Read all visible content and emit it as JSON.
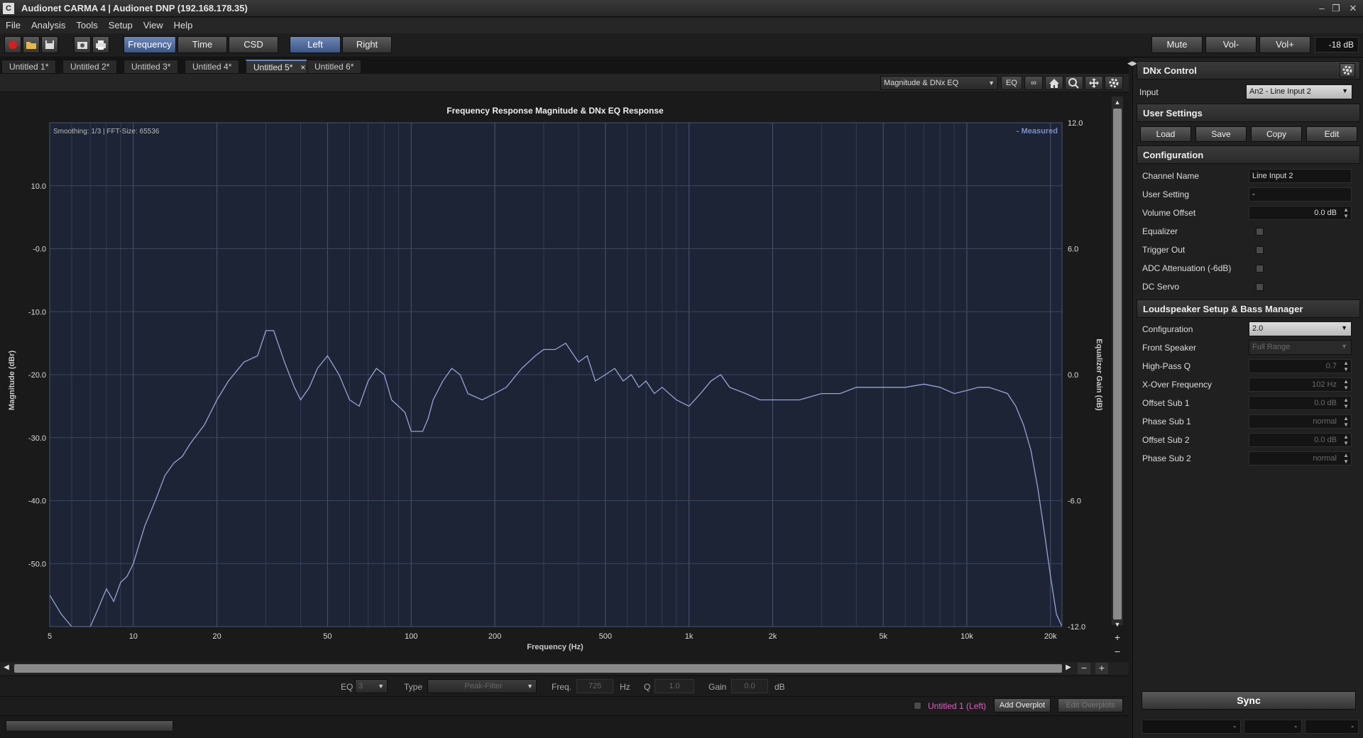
{
  "window": {
    "title": "Audionet CARMA 4 | Audionet DNP (192.168.178.35)",
    "min": "‒",
    "max": "❐",
    "close": "✕"
  },
  "menu": [
    "File",
    "Analysis",
    "Tools",
    "Setup",
    "View",
    "Help"
  ],
  "toolbar": {
    "modes": [
      "Frequency",
      "Time",
      "CSD"
    ],
    "channels": [
      "Left",
      "Right"
    ],
    "mute": "Mute",
    "vol_down": "Vol-",
    "vol_up": "Vol+",
    "volume": "-18 dB"
  },
  "tabs": [
    "Untitled 1*",
    "Untitled 2*",
    "Untitled 3*",
    "Untitled 4*",
    "Untitled 5*",
    "Untitled 6*"
  ],
  "tab_close": "×",
  "plot_toolbar": {
    "view_select": "Magnitude & DNx EQ",
    "eq_button": "EQ",
    "link_icon": "∞"
  },
  "chart_data": {
    "type": "line",
    "title": "Frequency Response Magnitude & DNx EQ Response",
    "info": "Smoothing: 1/3 | FFT-Size: 65536",
    "legend": "- Measured",
    "xlabel": "Frequency (Hz)",
    "ylabel": "Magnitude (dBr)",
    "y2label": "Equalizer Gain (dB)",
    "x_scale": "log",
    "xlim": [
      5,
      22000
    ],
    "ylim": [
      -60,
      20
    ],
    "y2lim": [
      -12,
      12
    ],
    "x_ticks": [
      5,
      10,
      20,
      50,
      100,
      200,
      500,
      1000,
      2000,
      5000,
      10000,
      20000
    ],
    "x_tick_labels": [
      "5",
      "10",
      "20",
      "50",
      "100",
      "200",
      "500",
      "1k",
      "2k",
      "5k",
      "10k",
      "20k"
    ],
    "y_ticks": [
      10,
      0,
      -10,
      -20,
      -30,
      -40,
      -50
    ],
    "y_tick_labels": [
      "10.0",
      "-0.0",
      "-10.0",
      "-20.0",
      "-30.0",
      "-40.0",
      "-50.0"
    ],
    "y2_ticks": [
      12,
      6,
      0,
      -6,
      -12
    ],
    "y2_tick_labels": [
      "12.0",
      "6.0",
      "0.0",
      "-6.0",
      "-12.0"
    ],
    "grid": true,
    "series": [
      {
        "name": "Measured",
        "color": "#9aa4d4",
        "x": [
          5,
          5.5,
          6,
          6.5,
          7,
          7.5,
          8,
          8.5,
          9,
          9.5,
          10,
          11,
          12,
          13,
          14,
          15,
          16,
          18,
          20,
          22,
          25,
          28,
          30,
          32,
          35,
          38,
          40,
          43,
          46,
          50,
          55,
          60,
          65,
          70,
          75,
          80,
          85,
          90,
          95,
          100,
          105,
          110,
          115,
          120,
          130,
          140,
          150,
          160,
          180,
          200,
          220,
          250,
          280,
          300,
          330,
          360,
          400,
          430,
          460,
          500,
          540,
          580,
          620,
          660,
          700,
          750,
          800,
          900,
          1000,
          1100,
          1200,
          1300,
          1400,
          1600,
          1800,
          2000,
          2500,
          3000,
          3500,
          4000,
          5000,
          6000,
          7000,
          8000,
          9000,
          10000,
          11000,
          12000,
          13000,
          14000,
          15000,
          16000,
          17000,
          18000,
          19000,
          20000,
          21000,
          22000
        ],
        "values": [
          -55,
          -58,
          -60,
          -60,
          -60,
          -57,
          -54,
          -56,
          -53,
          -52,
          -50,
          -44,
          -40,
          -36,
          -34,
          -33,
          -31,
          -28,
          -24,
          -21,
          -18,
          -17,
          -13,
          -13,
          -18,
          -22,
          -24,
          -22,
          -19,
          -17,
          -20,
          -24,
          -25,
          -21,
          -19,
          -20,
          -24,
          -25,
          -26,
          -29,
          -29,
          -29,
          -27,
          -24,
          -21,
          -19,
          -20,
          -23,
          -24,
          -23,
          -22,
          -19,
          -17,
          -16,
          -16,
          -15,
          -18,
          -17,
          -21,
          -20,
          -19,
          -21,
          -20,
          -22,
          -21,
          -23,
          -22,
          -24,
          -25,
          -23,
          -21,
          -20,
          -22,
          -23,
          -24,
          -24,
          -24,
          -23,
          -23,
          -22,
          -22,
          -22,
          -21.5,
          -22,
          -23,
          -22.5,
          -22,
          -22,
          -22.5,
          -23,
          -25,
          -28,
          -32,
          -38,
          -45,
          -52,
          -58,
          -60
        ]
      }
    ]
  },
  "eq_bar": {
    "eq_label": "EQ",
    "eq_value": "3",
    "type_label": "Type",
    "type_value": "Peak-Filter",
    "freq_label": "Freq.",
    "freq_value": "725",
    "freq_unit": "Hz",
    "q_label": "Q",
    "q_value": "1.0",
    "gain_label": "Gain",
    "gain_value": "0.0",
    "gain_unit": "dB"
  },
  "overplot": {
    "current": "Untitled 1 (Left)",
    "add": "Add Overplot",
    "edit": "Edit Overplots"
  },
  "panel": {
    "title": "DNx Control",
    "input_label": "Input",
    "input_value": "An2 - Line Input 2",
    "user_settings": "User Settings",
    "buttons": [
      "Load",
      "Save",
      "Copy",
      "Edit"
    ],
    "configuration": "Configuration",
    "rows": [
      {
        "label": "Channel Name",
        "value": "Line Input 2"
      },
      {
        "label": "User Setting",
        "value": "-"
      },
      {
        "label": "Volume Offset",
        "value": "0.0 dB"
      },
      {
        "label": "Equalizer"
      },
      {
        "label": "Trigger Out"
      },
      {
        "label": "ADC Attenuation (-6dB)"
      },
      {
        "label": "DC Servo"
      }
    ],
    "bass_manager": "Loudspeaker Setup & Bass Manager",
    "bm_rows": [
      {
        "label": "Configuration",
        "value": "2.0"
      },
      {
        "label": "Front Speaker",
        "value": "Full Range"
      },
      {
        "label": "High-Pass Q",
        "value": "0.7"
      },
      {
        "label": "X-Over Frequency",
        "value": "102 Hz"
      },
      {
        "label": "Offset Sub 1",
        "value": "0.0 dB"
      },
      {
        "label": "Phase Sub 1",
        "value": "normal"
      },
      {
        "label": "Offset Sub 2",
        "value": "0.0 dB"
      },
      {
        "label": "Phase Sub 2",
        "value": "normal"
      }
    ],
    "sync": "Sync",
    "status_fields": [
      "-",
      "-",
      "-"
    ]
  }
}
